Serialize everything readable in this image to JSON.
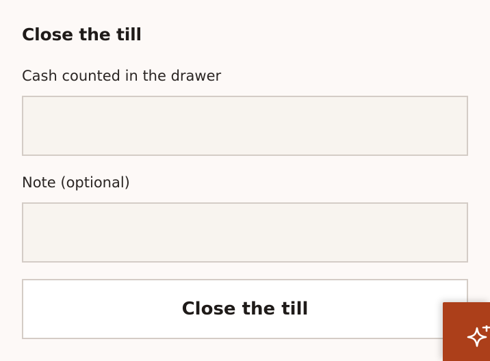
{
  "dialog": {
    "title": "Close the till",
    "cash_label": "Cash counted in the drawer",
    "cash_value": "",
    "note_label": "Note (optional)",
    "note_value": "",
    "submit_label": "Close the till"
  },
  "assistant": {
    "icon": "sparkle-icon"
  },
  "colors": {
    "background": "#fdf9f7",
    "input_background": "#f8f4ef",
    "border": "#d4ccc6",
    "accent": "#ac3f1a"
  }
}
